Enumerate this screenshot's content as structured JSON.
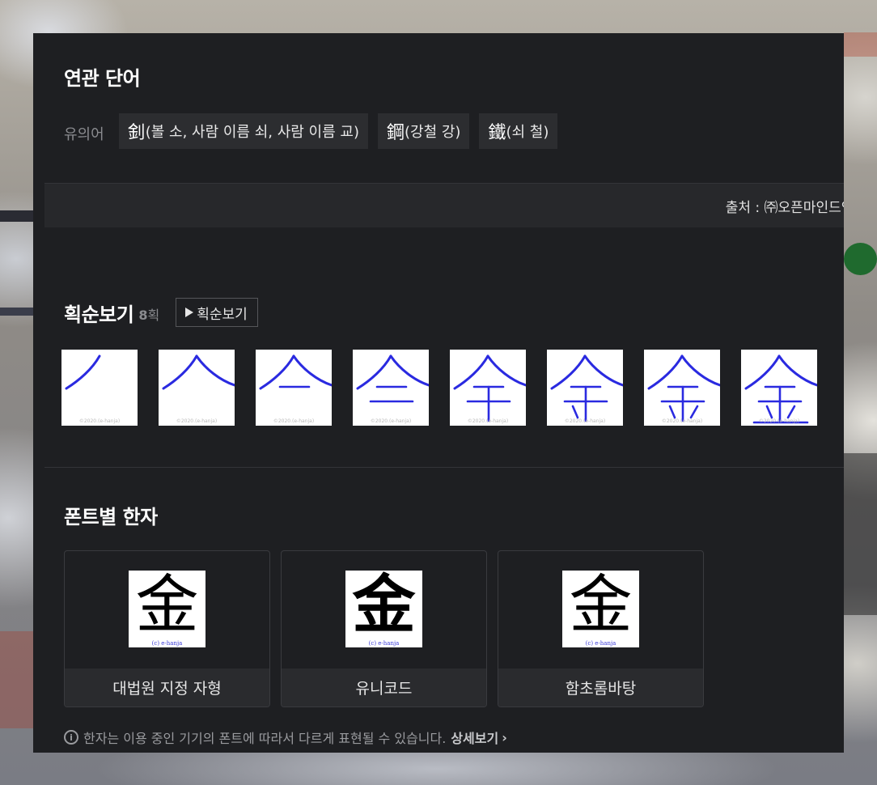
{
  "related": {
    "title": "연관 단어",
    "synonym_label": "유의어",
    "chips": [
      {
        "hanja": "釗",
        "meaning": "(볼 소, 사람 이름 쇠, 사람 이름 교)"
      },
      {
        "hanja": "鋼",
        "meaning": "(강철 강)"
      },
      {
        "hanja": "鐵",
        "meaning": "(쇠 철)"
      }
    ],
    "source": "출처 : ㈜오픈마인드인포"
  },
  "stroke_order": {
    "title": "획순보기",
    "count_num": "8",
    "count_unit": "획",
    "play_label": "획순보기",
    "watermark": "©2020.(e-hanja)",
    "stroke_color": "#2a2ae0",
    "total_frames": 8
  },
  "fonts": {
    "title": "폰트별 한자",
    "glyph": "金",
    "credit": "(c) e-hanja",
    "cards": [
      {
        "label": "대법원 지정 자형"
      },
      {
        "label": "유니코드"
      },
      {
        "label": "함초롬바탕"
      }
    ]
  },
  "notice": {
    "info_icon": "i",
    "text": "한자는 이용 중인 기기의 폰트에 따라서 다르게 표현될 수 있습니다.",
    "more": "상세보기",
    "chevron": "›"
  }
}
